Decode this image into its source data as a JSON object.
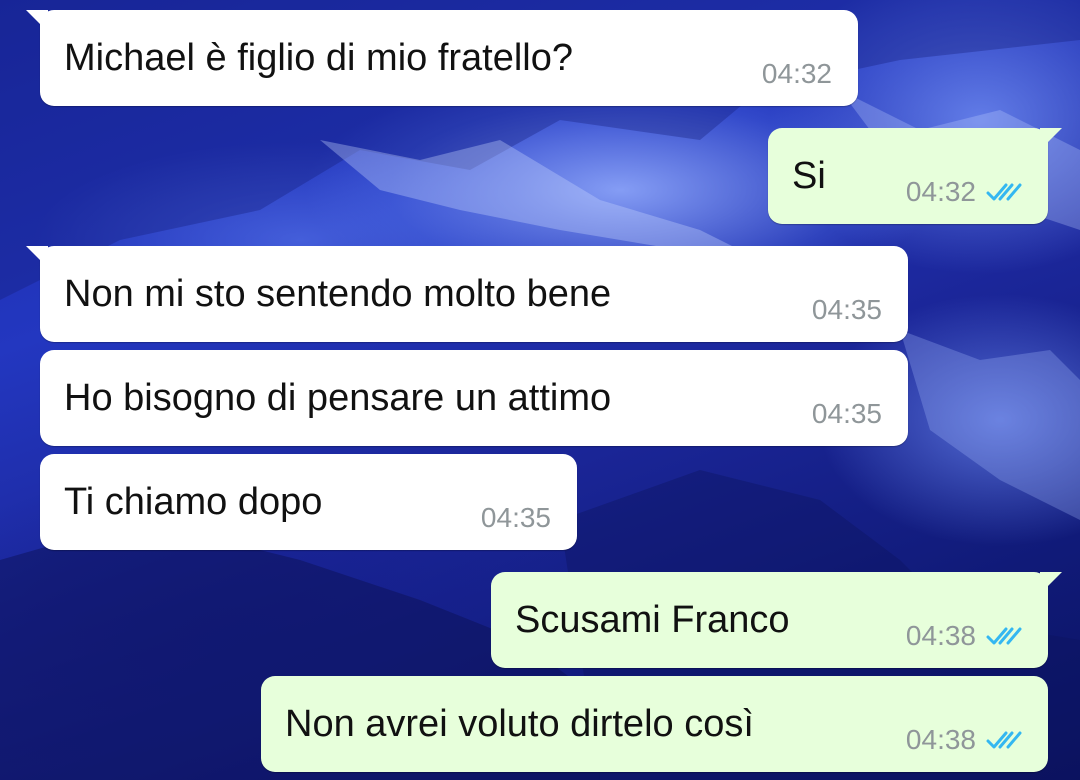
{
  "colors": {
    "incoming_bubble": "#ffffff",
    "outgoing_bubble": "#e7ffdb",
    "read_ticks": "#34b7f1",
    "timestamp": "#8f9699"
  },
  "messages": [
    {
      "direction": "incoming",
      "text": "Michael è figlio di mio fratello?",
      "time": "04:32"
    },
    {
      "direction": "outgoing",
      "text": "Si",
      "time": "04:32",
      "status_icon": "double-check-read-icon"
    },
    {
      "direction": "incoming",
      "text": "Non mi sto sentendo molto bene",
      "time": "04:35"
    },
    {
      "direction": "incoming",
      "text": "Ho bisogno di pensare un attimo",
      "time": "04:35"
    },
    {
      "direction": "incoming",
      "text": "Ti chiamo dopo",
      "time": "04:35"
    },
    {
      "direction": "outgoing",
      "text": "Scusami Franco",
      "time": "04:38",
      "status_icon": "double-check-read-icon"
    },
    {
      "direction": "outgoing",
      "text": "Non avrei voluto dirtelo così",
      "time": "04:38",
      "status_icon": "double-check-read-icon"
    }
  ]
}
